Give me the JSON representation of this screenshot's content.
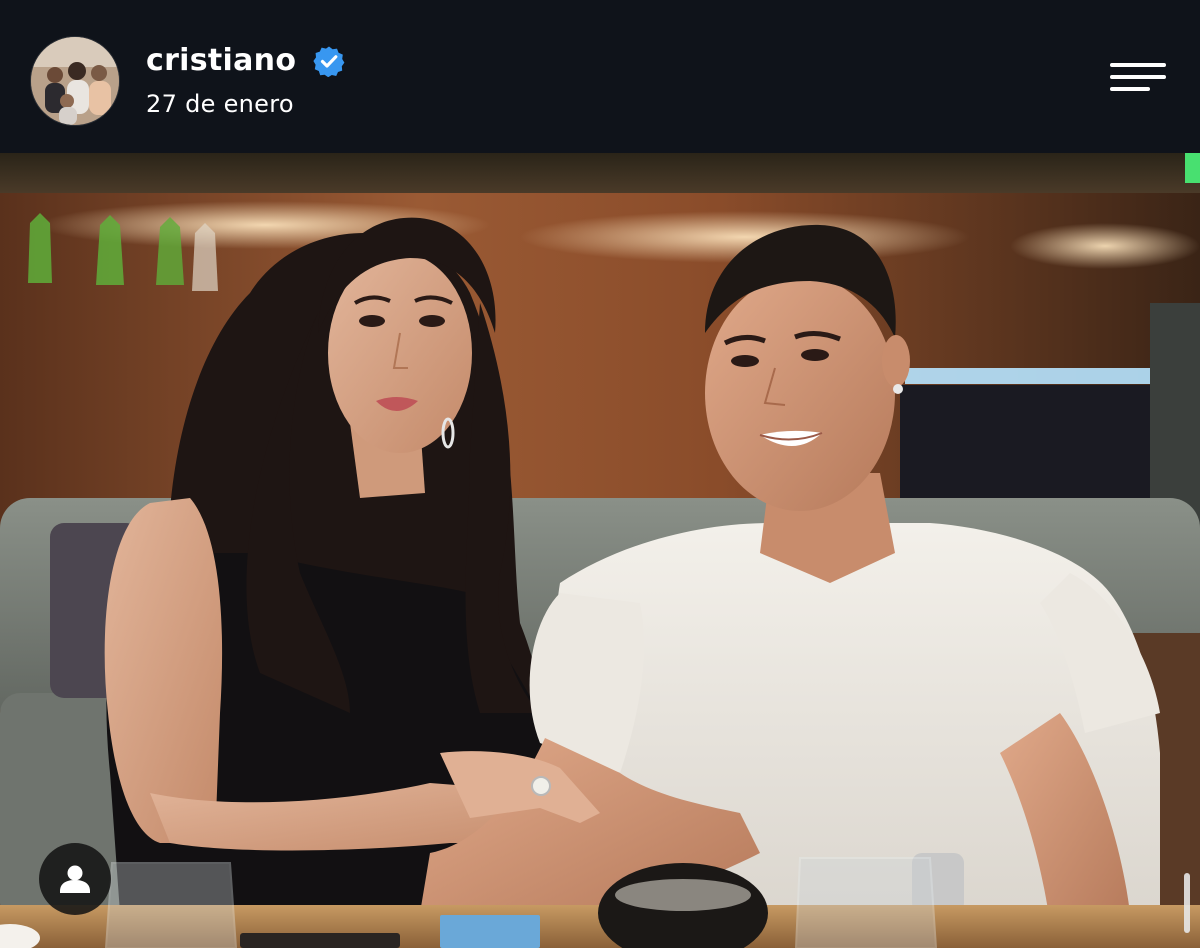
{
  "post": {
    "username": "cristiano",
    "verified": true,
    "date": "27 de enero"
  },
  "icons": {
    "avatar": "profile-avatar",
    "verified": "verified-badge-icon",
    "menu": "hamburger-menu-icon",
    "tag": "user-tag-icon"
  },
  "colors": {
    "header_bg": "#0f131a",
    "verified_blue": "#3897f0",
    "text": "#ffffff"
  }
}
